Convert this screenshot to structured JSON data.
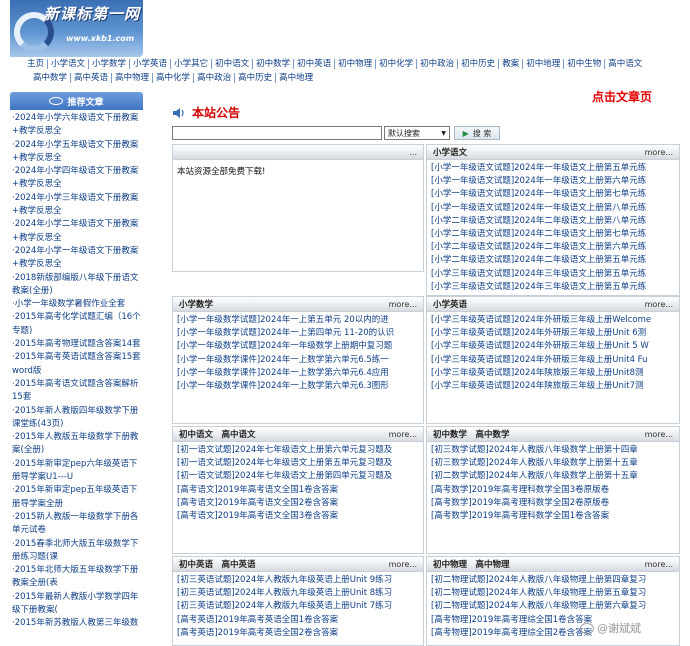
{
  "logo": {
    "title": "新课标第一网",
    "url": "www.xkb1.com"
  },
  "nav": {
    "row1": [
      "主页",
      "小学语文",
      "小学数学",
      "小学英语",
      "小学其它",
      "初中语文",
      "初中数学",
      "初中英语",
      "初中物理",
      "初中化学",
      "初中政治",
      "初中历史",
      "教案",
      "初中地理",
      "初中生物",
      "高中语文"
    ],
    "row2": [
      "高中数学",
      "高中英语",
      "高中物理",
      "高中化学",
      "高中政治",
      "高中历史",
      "高中地理"
    ]
  },
  "sidebar": {
    "title": "推荐文章",
    "items": [
      "·2024年小学六年级语文下册教案+教学反思全",
      "·2024年小学五年级语文下册教案+教学反思全",
      "·2024年小学四年级语文下册教案+教学反思全",
      "·2024年小学三年级语文下册教案+教学反思全",
      "·2024年小学二年级语文下册教案+教学反思全",
      "·2024年小学一年级语文下册教案+教学反思全",
      "·2018新版部编版八年级下册语文教案(全册)",
      "·小学一年级数学暑假作业全套",
      "·2015年高考化学试题汇编（16个专题)",
      "·2015年高考物理试题含答案14套",
      "·2015年高考英语试题含答案15套word版",
      "·2015年高考语文试题含答案解析15套",
      "·2015年新人教版四年级数学下册课堂练(43页)",
      "·2015年人教版五年级数学下册教案(全册)",
      "·2015年新审定pep六年级英语下册导学案U1---U",
      "·2015年新审定pep五年级英语下册导学案全册",
      "·2015新人教版一年级数学下册各单元试卷",
      "·2015春季北师大版五年级数学下册练习题(课",
      "·2015年北师大版五年级数学下册教案全册(表",
      "·2015年最新人教版小学数学四年级下册教案(",
      "·2015年新苏教版人教第三年级数"
    ]
  },
  "main": {
    "marquee": "点击文章页",
    "notice_title": "本站公告",
    "search": {
      "input_value": "",
      "select_value": "默认搜索",
      "button_label": "搜 索"
    },
    "notice_box": {
      "more": "...",
      "text": "本站资源全部免费下载!"
    },
    "boxes": [
      {
        "title": "小学语文",
        "more": "more...",
        "items": [
          "[小学一年级语文试题]2024年一年级语文上册第五单元练",
          "[小学一年级语文试题]2024年一年级语文上册第六单元练",
          "[小学一年级语文试题]2024年一年级语文上册第七单元练",
          "[小学一年级语文试题]2024年一年级语文上册第八单元练",
          "[小学二年级语文试题]2024年二年级语文上册第八单元练",
          "[小学二年级语文试题]2024年二年级语文上册第七单元练",
          "[小学二年级语文试题]2024年二年级语文上册第六单元练",
          "[小学二年级语文试题]2024年二年级语文上册第五单元练",
          "[小学三年级语文试题]2024年三年级语文上册第五单元练",
          "[小学三年级语文试题]2024年三年级语文上册第五单元练"
        ]
      },
      {
        "title": "小学数学",
        "more": "more...",
        "items": [
          "[小学一年级数学试题]2024年一上第五单元 20以内的进",
          "[小学一年级数学试题]2024年一上第四单元 11-20的认识",
          "[小学一年级数学试题]2024年一年级数学上册期中复习题",
          "[小学一年级数学课件]2024年一上数学第六单元6.5练一",
          "[小学一年级数学课件]2024年一上数学第六单元6.4应用",
          "[小学一年级数学课件]2024年一上数学第六单元6.3图形"
        ]
      },
      {
        "title": "小学英语",
        "more": "more...",
        "items": [
          "[小学三年级英语试题]2024年外研版三年级上册Welcome",
          "[小学三年级英语试题]2024年外研版三年级上册Unit 6测",
          "[小学三年级英语试题]2024年外研版三年级上册Unit 5 W",
          "[小学三年级英语试题]2024年外研版三年级上册Unit4 Fu",
          "[小学三年级英语试题]2024年陕旅版三年级上册Unit8测",
          "[小学三年级英语试题]2024年陕旅版三年级上册Unit7测"
        ]
      },
      {
        "title": "初中语文　高中语文",
        "more": "more...",
        "items": [
          "[初一语文试题]2024年七年级语文上册第六单元复习题及",
          "[初一语文试题]2024年七年级语文上册第五单元复习题及",
          "[初一语文试题]2024年七年级语文上册第四单元复习题及",
          "[高考语文]2019年高考语文全国1卷含答案",
          "[高考语文]2019年高考语文全国2卷含答案",
          "[高考语文]2019年高考语文全国3卷含答案"
        ]
      },
      {
        "title": "初中数学　高中数学",
        "more": "more...",
        "items": [
          "[初三数学试题]2024年人教版八年级数学上册第十四章",
          "[初三数学试题]2024年人教版八年级数学上册第十五章",
          "[初二数学试题]2024年人教版八年级数学上册第十五章",
          "[高考数学]2019年高考理科数学全国3卷原版卷",
          "[高考数学]2019年高考理科数学全国2卷原版卷",
          "[高考数学]2019年高考理科数学全国1卷含答案"
        ]
      },
      {
        "title": "初中英语　高中英语",
        "more": "more...",
        "items": [
          "[初三英语试题]2024年人教版九年级英语上册Unit 9练习",
          "[初三英语试题]2024年人教版九年级英语上册Unit 8练习",
          "[初三英语试题]2024年人教版九年级英语上册Unit 7练习",
          "[高考英语]2019年高考英语全国1卷含答案",
          "[高考英语]2019年高考英语全国2卷含答案"
        ]
      },
      {
        "title": "初中物理　高中物理",
        "more": "more...",
        "items": [
          "[初二物理试题]2024年人教版八年级物理上册第四章复习",
          "[初二物理试题]2024年人教版八年级物理上册第五章复习",
          "[初二物理试题]2024年人教版八年级物理上册第六章复习",
          "[高考物理]2019年高考理综全国1卷含答案",
          "[高考物理]2019年高考理综全国2卷含答案"
        ]
      }
    ]
  },
  "watermark": "@谢斌斌"
}
